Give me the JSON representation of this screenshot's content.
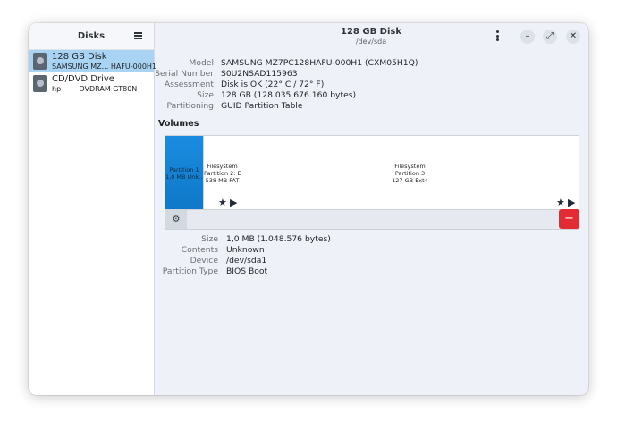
{
  "sidebar": {
    "title": "Disks",
    "items": [
      {
        "name": "128 GB Disk",
        "sub": "SAMSUNG MZ...  HAFU-000H1",
        "selected": true
      },
      {
        "name": "CD/DVD Drive",
        "sub": "hp        DVDRAM GT80N",
        "selected": false
      }
    ]
  },
  "header": {
    "title": "128 GB Disk",
    "subtitle": "/dev/sda",
    "minimize": "–",
    "maximize": "⤢",
    "close": "✕"
  },
  "disk_info": {
    "model_label": "Model",
    "model": "SAMSUNG MZ7PC128HAFU-000H1 (CXM05H1Q)",
    "serial_label": "Serial Number",
    "serial": "S0U2NSAD115963",
    "assessment_label": "Assessment",
    "assessment": "Disk is OK (22° C / 72° F)",
    "size_label": "Size",
    "size": "128 GB (128.035.676.160 bytes)",
    "partitioning_label": "Partitioning",
    "partitioning": "GUID Partition Table"
  },
  "volumes": {
    "title": "Volumes",
    "partitions": [
      {
        "line1": "Partition 1",
        "line2": "1,0 MB Unk..."
      },
      {
        "line1": "Filesystem",
        "line2": "Partition 2: E...",
        "line3": "538 MB FAT"
      },
      {
        "line1": "Filesystem",
        "line2": "Partition 3",
        "line3": "127 GB Ext4"
      }
    ],
    "star": "★",
    "play": "▶",
    "gear": "⚙",
    "delete": "−"
  },
  "partition_info": {
    "size_label": "Size",
    "size": "1,0 MB (1.048.576 bytes)",
    "contents_label": "Contents",
    "contents": "Unknown",
    "device_label": "Device",
    "device": "/dev/sda1",
    "type_label": "Partition Type",
    "type": "BIOS Boot"
  }
}
